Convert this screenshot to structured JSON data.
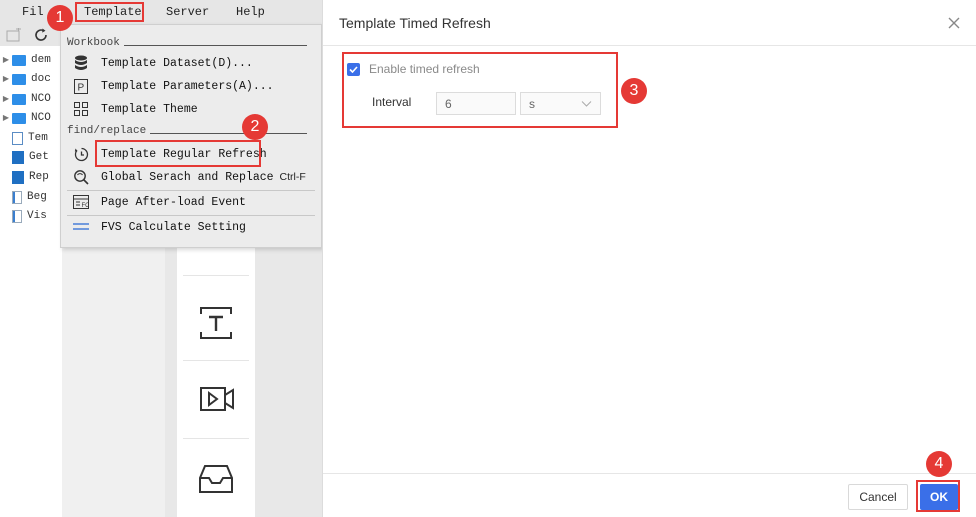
{
  "menubar": {
    "file": "Fil",
    "template": "Template",
    "server": "Server",
    "help": "Help"
  },
  "tree": {
    "items": [
      {
        "label": "dem",
        "kind": "folder",
        "expandable": true
      },
      {
        "label": "doc",
        "kind": "folder",
        "expandable": true
      },
      {
        "label": "NCO",
        "kind": "folder",
        "expandable": true
      },
      {
        "label": "NCO",
        "kind": "folder",
        "expandable": true
      },
      {
        "label": "Tem",
        "kind": "file",
        "expandable": false
      },
      {
        "label": "Get",
        "kind": "report",
        "expandable": false
      },
      {
        "label": "Rep",
        "kind": "report",
        "expandable": false
      },
      {
        "label": "Beg",
        "kind": "bar",
        "expandable": false
      },
      {
        "label": "Vis",
        "kind": "bar",
        "expandable": false
      }
    ]
  },
  "dropdown": {
    "workbook_group": "Workbook",
    "findreplace_group": "find/replace",
    "items": [
      {
        "label": "Template Dataset(D)...",
        "icon": "database-icon",
        "shortcut": ""
      },
      {
        "label": "Template Parameters(A)...",
        "icon": "parameter-icon",
        "shortcut": ""
      },
      {
        "label": "Template Theme",
        "icon": "theme-grid-icon",
        "shortcut": ""
      },
      {
        "label": "Template Regular Refresh",
        "icon": "refresh-clock-icon",
        "shortcut": ""
      },
      {
        "label": "Global Serach and Replace",
        "icon": "search-replace-icon",
        "shortcut": "Ctrl-F"
      },
      {
        "label": "Page After-load Event",
        "icon": "page-event-icon",
        "shortcut": ""
      },
      {
        "label": "FVS Calculate Setting",
        "icon": "fvs-lines-icon",
        "shortcut": ""
      }
    ]
  },
  "widgets": [
    "text-widget-icon",
    "video-widget-icon",
    "inbox-widget-icon"
  ],
  "dialog": {
    "title": "Template Timed Refresh",
    "enable_label": "Enable timed refresh",
    "enable_checked": true,
    "interval_label": "Interval",
    "interval_value": "6",
    "unit_value": "s",
    "cancel_label": "Cancel",
    "ok_label": "OK",
    "accent_color": "#3a6fe8"
  },
  "annotations": {
    "steps": [
      "1",
      "2",
      "3",
      "4"
    ],
    "color": "#e53935"
  }
}
